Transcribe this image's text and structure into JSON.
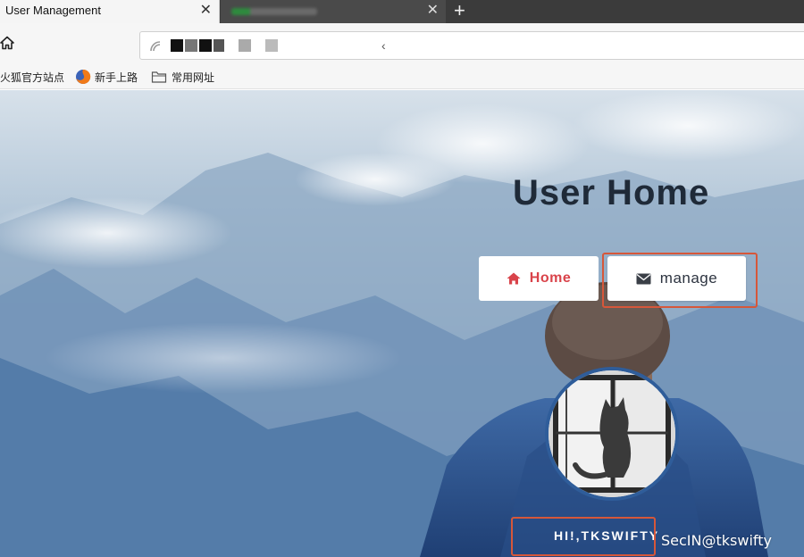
{
  "browser": {
    "tabs": [
      {
        "title": "User Management",
        "active": true
      },
      {
        "title": "",
        "active": false
      }
    ],
    "close_symbol": "✕",
    "new_tab_symbol": "+",
    "url_caret": "‹",
    "bookmarks": [
      {
        "label": "火狐官方站点",
        "icon": "firefox-icon"
      },
      {
        "label": "新手上路",
        "icon": "firefox-icon"
      },
      {
        "label": "常用网址",
        "icon": "folder-icon"
      }
    ]
  },
  "page": {
    "title": "User Home",
    "buttons": {
      "home": {
        "label": "Home",
        "icon": "home-icon",
        "color": "#d9434a"
      },
      "manage": {
        "label": "manage",
        "icon": "envelope-icon",
        "color": "#2d3440"
      }
    },
    "greeting": "HI!,TKSWIFTY",
    "highlight_color": "#d6573a"
  },
  "watermark": "SecIN@tkswifty"
}
